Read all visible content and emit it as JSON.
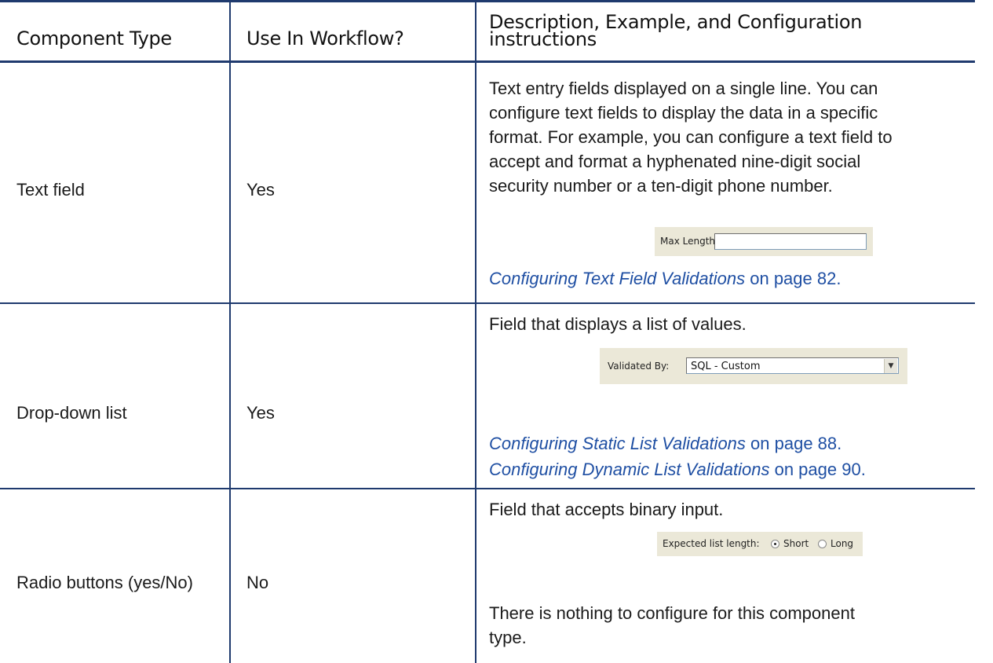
{
  "table": {
    "headers": {
      "component_type": "Component Type",
      "use_in_workflow": "Use In Workflow?",
      "description": "Description, Example, and Configuration instructions"
    },
    "rows": [
      {
        "component": "Text field",
        "workflow": "Yes",
        "description_lines": [
          "Text entry fields displayed on a single line. You can",
          "configure text fields to display the data in a specific",
          "format. For example, you can configure a text field to",
          "accept and format a hyphenated nine-digit social",
          "security number or a ten-digit phone number."
        ],
        "example": {
          "label": "Max Length:",
          "value": ""
        },
        "links": [
          {
            "title": "Configuring Text Field Validations",
            "suffix": " on page 82."
          }
        ]
      },
      {
        "component": "Drop-down list",
        "workflow": "Yes",
        "description_lines": [
          "Field that displays a list of values."
        ],
        "example": {
          "label": "Validated By:",
          "value": "SQL - Custom"
        },
        "links": [
          {
            "title": "Configuring Static List Validations",
            "suffix": " on page 88."
          },
          {
            "title": "Configuring Dynamic List Validations",
            "suffix": " on page 90."
          }
        ]
      },
      {
        "component": "Radio buttons (yes/No)",
        "workflow": "No",
        "description_lines": [
          "Field that accepts binary input."
        ],
        "example": {
          "label": "Expected list length:",
          "option1": "Short",
          "option2": "Long",
          "selected": "Short"
        },
        "note_lines": [
          "There is nothing to configure for this component",
          "type."
        ]
      }
    ]
  },
  "colors": {
    "rule": "#1f3a6e",
    "link": "#1f4fa3",
    "widget_bg": "#ebe8d8"
  }
}
